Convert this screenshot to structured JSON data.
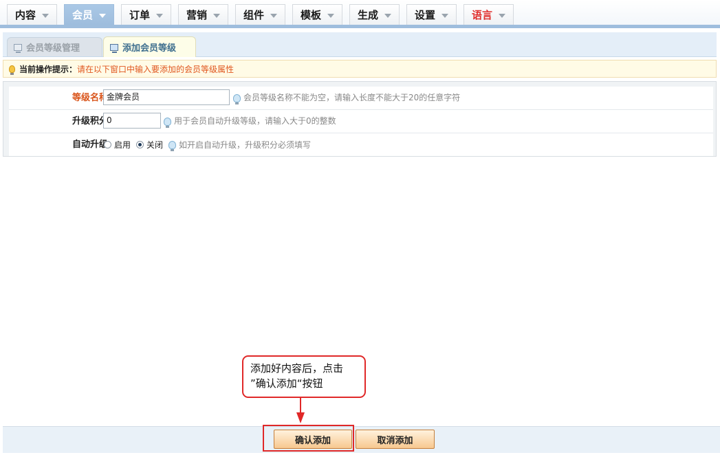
{
  "nav": {
    "tabs": [
      {
        "label": "内容"
      },
      {
        "label": "会员"
      },
      {
        "label": "订单"
      },
      {
        "label": "营销"
      },
      {
        "label": "组件"
      },
      {
        "label": "模板"
      },
      {
        "label": "生成"
      },
      {
        "label": "设置"
      },
      {
        "label": "语言"
      }
    ],
    "active_tab": "会员"
  },
  "subtabs": {
    "manage": "会员等级管理",
    "add": "添加会员等级"
  },
  "tip": {
    "label": "当前操作提示：",
    "text": "请在以下窗口中输入要添加的会员等级属性"
  },
  "form": {
    "name": {
      "label": "等级名称",
      "value": "金牌会员",
      "hint": "会员等级名称不能为空，请输入长度不能大于20的任意字符"
    },
    "points": {
      "label": "升级积分",
      "value": "0",
      "hint": "用于会员自动升级等级，请输入大于0的整数"
    },
    "auto": {
      "label": "自动升级",
      "enable_label": "启用",
      "disable_label": "关闭",
      "selected": "关闭",
      "hint": "如开启自动升级，升级积分必须填写"
    }
  },
  "callout": {
    "line1": "添加好内容后，点击",
    "line2": "”确认添加“按钮"
  },
  "buttons": {
    "confirm": "确认添加",
    "cancel": "取消添加"
  },
  "colors": {
    "accent_blue": "#9ebddd",
    "required_label": "#d9541a",
    "callout_red": "#e02828",
    "button_orange": "#f7c88f"
  }
}
